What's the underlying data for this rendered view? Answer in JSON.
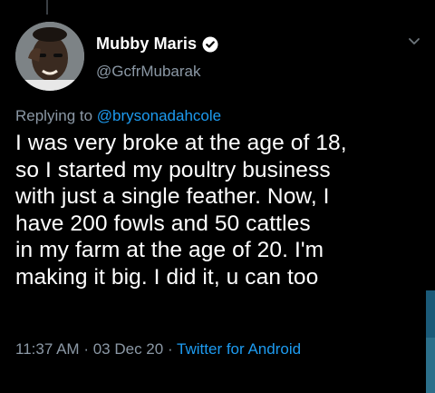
{
  "tweet": {
    "display_name": "Mubby Maris",
    "handle": "@GcfrMubarak",
    "replying_prefix": "Replying to",
    "replying_to": "@brysonadahcole",
    "text": "I was very broke at the age of 18,\nso I started my poultry  business\nwith just a single feather.  Now,  I\nhave 200 fowls and 50 cattles\nin my farm at the age of 20.  I'm\nmaking it big. I did it,  u can too",
    "time": "11:37 AM",
    "separator": "·",
    "date": "03 Dec 20",
    "source": "Twitter for Android"
  },
  "colors": {
    "background": "#000000",
    "primary_text": "#ffffff",
    "secondary_text": "#8b98a5",
    "accent": "#1d9bf0"
  },
  "icons": {
    "verified": "verified-badge-icon",
    "more": "chevron-down-icon"
  }
}
